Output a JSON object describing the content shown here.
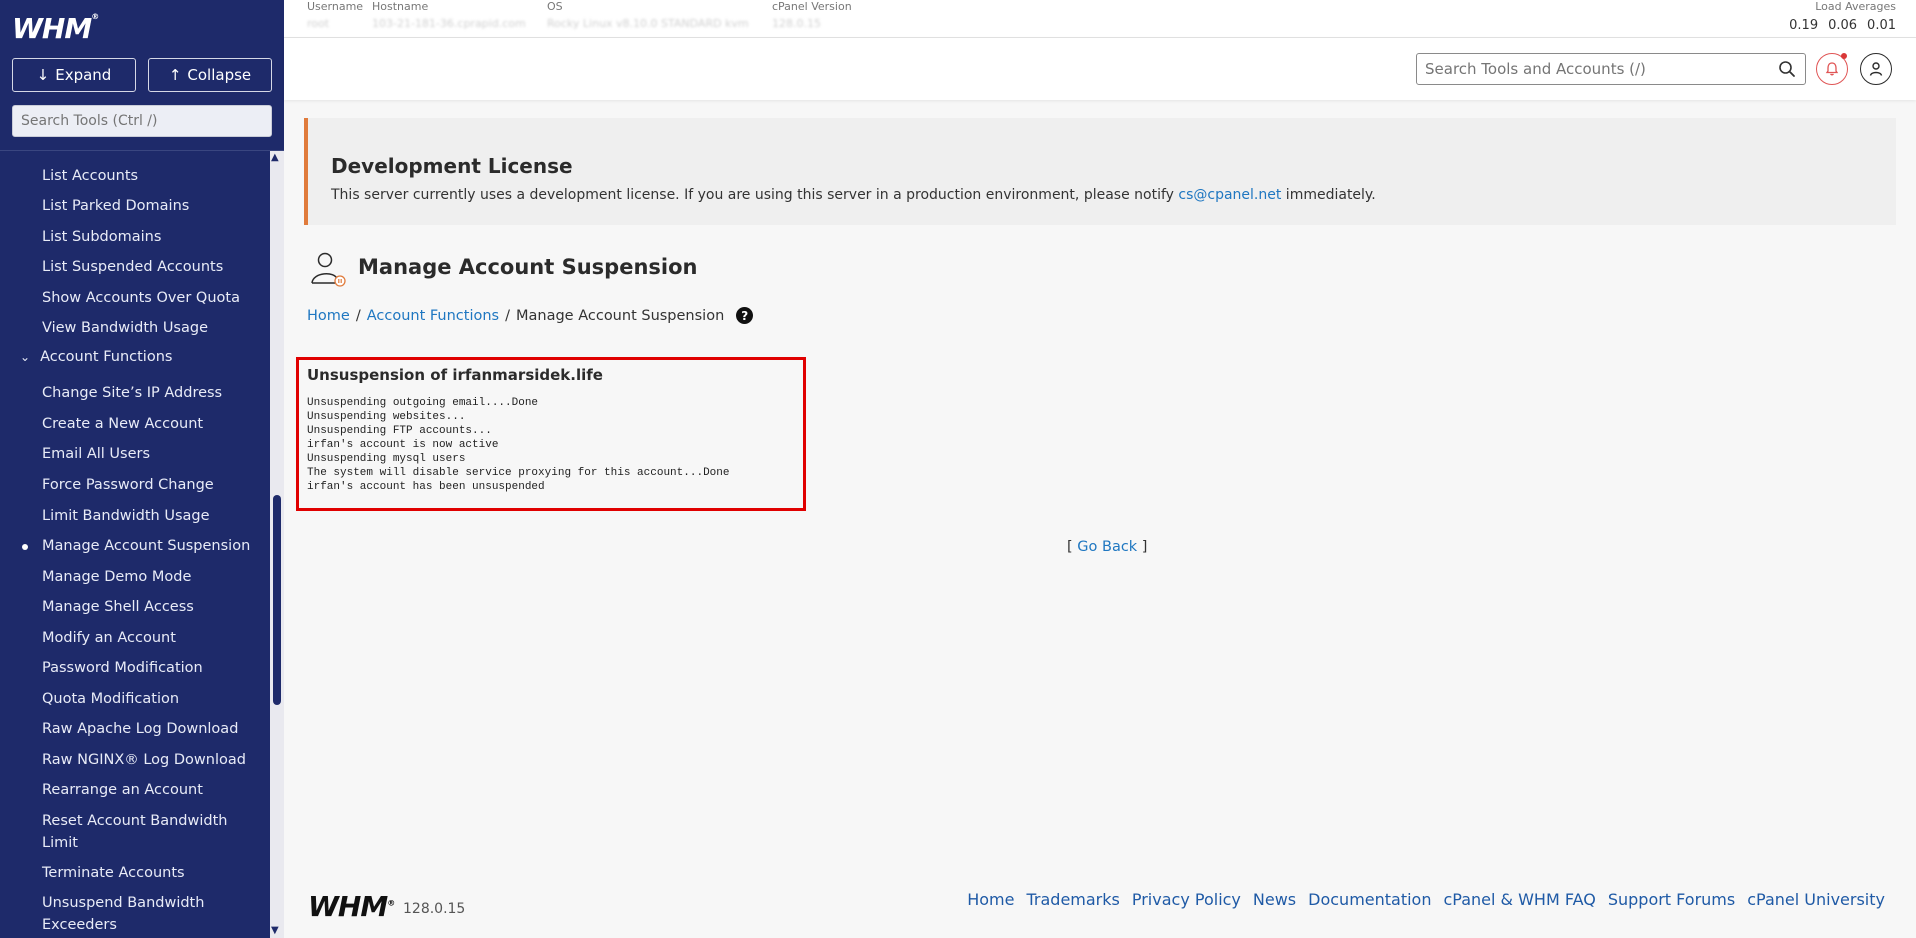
{
  "sidebar": {
    "logo": "WHM",
    "expand_label": "Expand",
    "collapse_label": "Collapse",
    "search_placeholder": "Search Tools (Ctrl /)",
    "items_top": [
      "List Accounts",
      "List Parked Domains",
      "List Subdomains",
      "List Suspended Accounts",
      "Show Accounts Over Quota",
      "View Bandwidth Usage"
    ],
    "category": "Account Functions",
    "items": [
      "Change Site’s IP Address",
      "Create a New Account",
      "Email All Users",
      "Force Password Change",
      "Limit Bandwidth Usage",
      "Manage Account Suspension",
      "Manage Demo Mode",
      "Manage Shell Access",
      "Modify an Account",
      "Password Modification",
      "Quota Modification",
      "Raw Apache Log Download",
      "Raw NGINX® Log Download",
      "Rearrange an Account",
      "Reset Account Bandwidth Limit",
      "Terminate Accounts",
      "Unsuspend Bandwidth Exceeders"
    ],
    "active_item": "Manage Account Suspension"
  },
  "infobar": {
    "username_label": "Username",
    "username_value": "root",
    "hostname_label": "Hostname",
    "hostname_value": "103-21-181-36.cprapid.com",
    "os_label": "OS",
    "os_value": "Rocky Linux v8.10.0 STANDARD kvm",
    "version_label": "cPanel Version",
    "version_value": "128.0.15",
    "load_label": "Load Averages",
    "load_values": [
      "0.19",
      "0.06",
      "0.01"
    ]
  },
  "header": {
    "search_placeholder": "Search Tools and Accounts (/)"
  },
  "notice": {
    "title": "Development License",
    "text_before": "This server currently uses a development license. If you are using this server in a production environment, please notify ",
    "email": "cs@cpanel.net",
    "text_after": " immediately."
  },
  "page": {
    "title": "Manage Account Suspension",
    "breadcrumb": [
      "Home",
      "Account Functions",
      "Manage Account Suspension"
    ]
  },
  "result": {
    "title": "Unsuspension of irfanmarsidek.life",
    "log": "Unsuspending outgoing email....Done\nUnsuspending websites...\nUnsuspending FTP accounts...\nirfan's account is now active\nUnsuspending mysql users\nThe system will disable service proxying for this account...Done\nirfan's account has been unsuspended"
  },
  "goback": {
    "open": "[ ",
    "link": "Go Back",
    "close": " ]"
  },
  "footer": {
    "logo": "WHM",
    "version": "128.0.15",
    "links": [
      "Home",
      "Trademarks",
      "Privacy Policy",
      "News",
      "Documentation",
      "cPanel & WHM FAQ",
      "Support Forums",
      "cPanel University"
    ]
  },
  "colors": {
    "sidebar_bg": "#1e2a6a",
    "accent_link": "#1f77c1",
    "notice_border": "#e07b3c",
    "highlight_red": "#e00000"
  }
}
